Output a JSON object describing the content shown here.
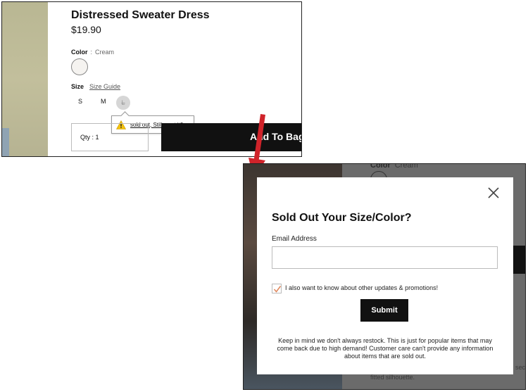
{
  "product": {
    "title": "Distressed Sweater Dress",
    "price": "$19.90",
    "color_label": "Color",
    "color_separator": ":",
    "color_value": "Cream",
    "size_label": "Size",
    "size_guide": "Size Guide",
    "sizes": [
      "S",
      "M",
      "L"
    ],
    "sold_out_size": "L",
    "tooltip_text": "sold out, Still want it?",
    "qty_label": "Qty : 1",
    "add_button": "Add To Bag"
  },
  "background_page": {
    "color_label": "Color",
    "color_value": "Cream",
    "text_fragment_1": "sec",
    "text_fragment_2": "fitted silhouette."
  },
  "modal": {
    "title": "Sold Out Your Size/Color?",
    "email_label": "Email Address",
    "email_value": "",
    "email_placeholder": "",
    "promo_checked": true,
    "promo_label": "I also want to know about other updates & promotions!",
    "submit_label": "Submit",
    "notice": "Keep in mind we don't always restock. This is just for popular items that may come back due to high demand! Customer care can't provide any information about items that are sold out."
  },
  "colors": {
    "arrow": "#d0232a",
    "warning": "#f4c20d",
    "checkmark": "#e0895f",
    "button_bg": "#111111"
  },
  "icons": [
    "warning-icon",
    "close-icon",
    "checkmark-icon",
    "arrow-down-icon"
  ]
}
